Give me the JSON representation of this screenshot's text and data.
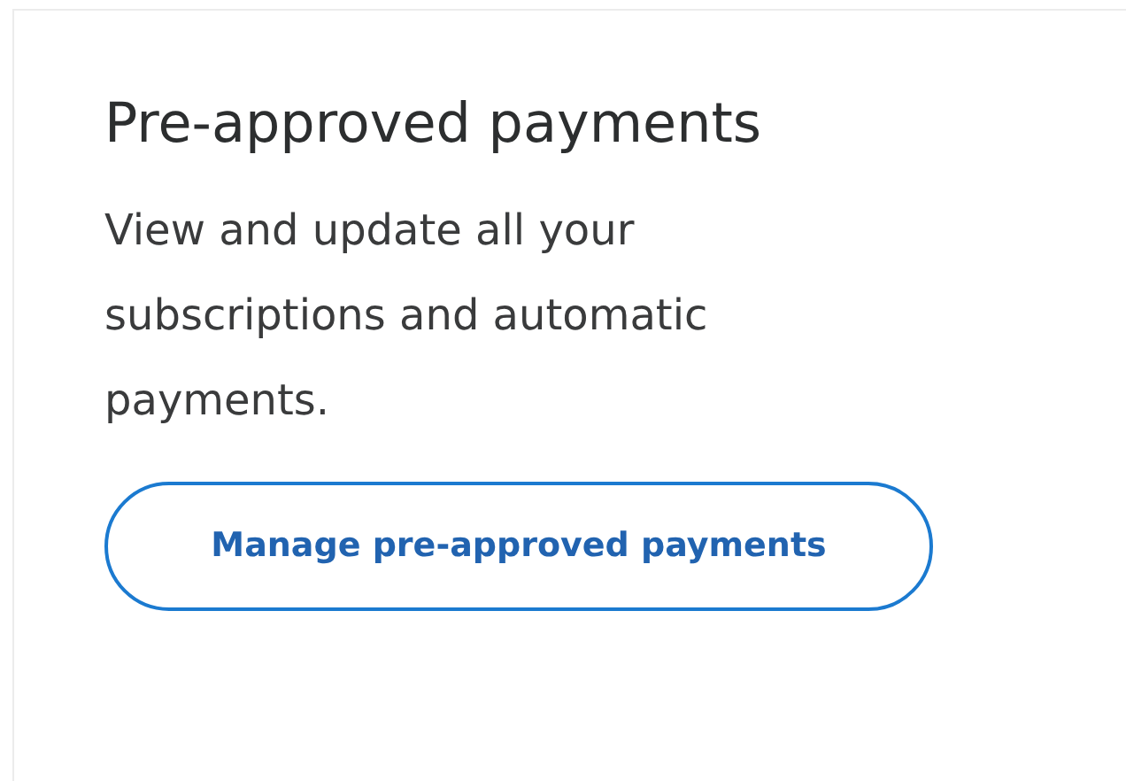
{
  "card": {
    "title": "Pre-approved payments",
    "description": "View and update all your subscriptions and automatic payments.",
    "button": "Manage pre-approved payments"
  }
}
